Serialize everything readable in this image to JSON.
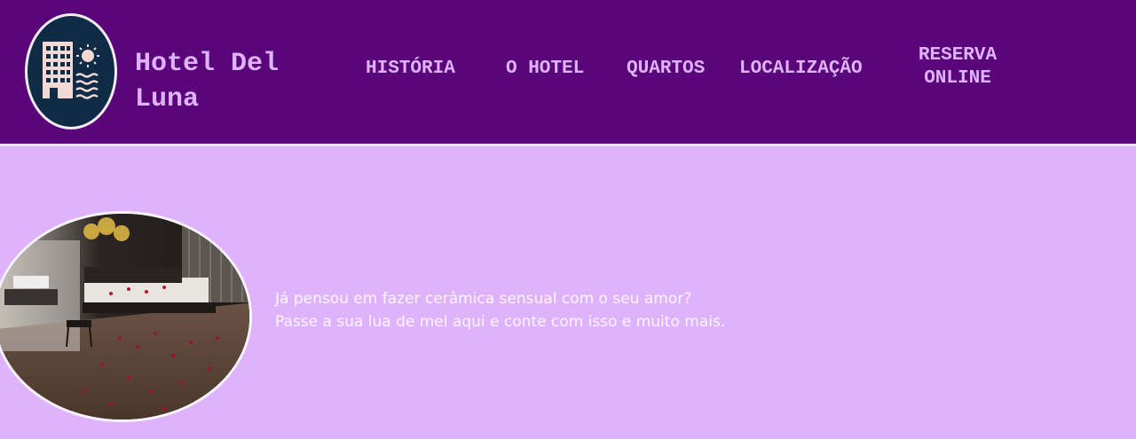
{
  "header": {
    "brand": "Hotel Del Luna",
    "logo_icon": "hotel-building-sun-waves-icon",
    "nav": [
      {
        "label": "HISTÓRIA"
      },
      {
        "label": "O HOTEL"
      },
      {
        "label": "QUARTOS"
      },
      {
        "label": "LOCALIZAÇÃO"
      },
      {
        "label": "RESERVA ONLINE"
      }
    ]
  },
  "hero": {
    "image": "hotel-suite-room-photo",
    "line1": "Já pensou em fazer cerâmica sensual com o seu amor?",
    "line2": "Passe a sua lua de mel aqui e conte com isso e muito mais."
  },
  "colors": {
    "header_bg": "#5a067a",
    "page_bg": "#deb3fc",
    "nav_text": "#deb3fc",
    "logo_bg": "#0f2b45",
    "hero_text": "#fbf6ff"
  }
}
